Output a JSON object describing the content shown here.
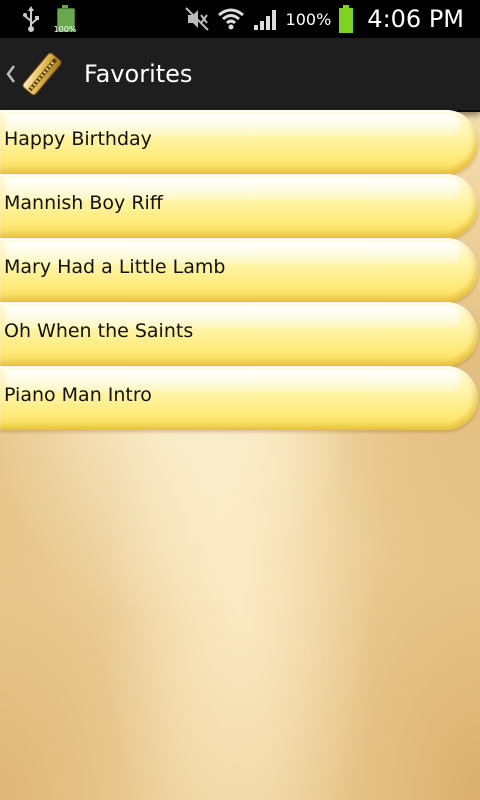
{
  "status_bar": {
    "small_battery_pct": "100%",
    "battery_pct": "100%",
    "time": "4:06 PM"
  },
  "action_bar": {
    "title": "Favorites",
    "back_icon": "chevron-left-icon",
    "app_icon": "harmonica-icon"
  },
  "favorites": [
    {
      "label": "Happy Birthday"
    },
    {
      "label": "Mannish Boy Riff"
    },
    {
      "label": "Mary Had a Little Lamb"
    },
    {
      "label": "Oh When the Saints"
    },
    {
      "label": "Piano Man Intro"
    }
  ],
  "colors": {
    "action_bar": "#1e1e1e",
    "list_item": "#fff3a0",
    "background": "#f3dcaa"
  }
}
